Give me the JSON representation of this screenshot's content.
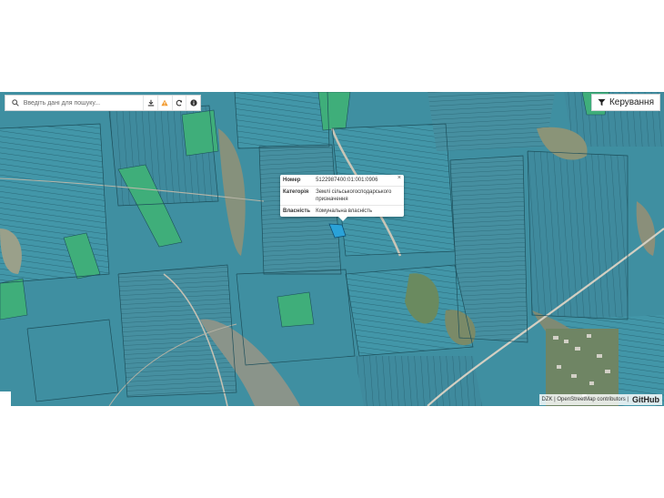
{
  "search": {
    "placeholder": "Введіть дані для пошуку..."
  },
  "toolbar": {
    "icons": [
      "download-icon",
      "warning-icon",
      "refresh-icon",
      "info-icon"
    ]
  },
  "manage_button": {
    "label": "Керування"
  },
  "popup": {
    "rows": [
      {
        "key": "Номер",
        "value": "5122987400:01:001:0906"
      },
      {
        "key": "Категорія",
        "value": "Землі сільськогосподарського призначення"
      },
      {
        "key": "Власність",
        "value": "Комунальна власність"
      }
    ],
    "close": "×"
  },
  "attribution": {
    "text": "DZK | OpenStreetMap contributors |",
    "github": "GitHub"
  },
  "colors": {
    "parcel": "#3f8fa1",
    "parcel_alt": "#4ea3b1",
    "green_parcel": "#3fae7a",
    "border": "#1d4f5b"
  }
}
